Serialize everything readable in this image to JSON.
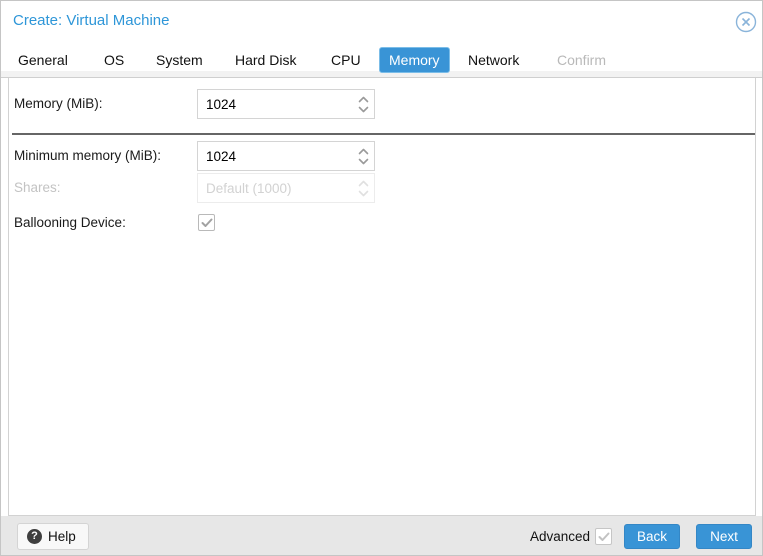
{
  "window": {
    "title": "Create: Virtual Machine",
    "close_icon": "circle-x"
  },
  "tabs": [
    {
      "label": "General",
      "state": "normal"
    },
    {
      "label": "OS",
      "state": "normal"
    },
    {
      "label": "System",
      "state": "normal"
    },
    {
      "label": "Hard Disk",
      "state": "normal"
    },
    {
      "label": "CPU",
      "state": "normal"
    },
    {
      "label": "Memory",
      "state": "active"
    },
    {
      "label": "Network",
      "state": "normal"
    },
    {
      "label": "Confirm",
      "state": "disabled"
    }
  ],
  "form": {
    "memory": {
      "label": "Memory (MiB):",
      "value": "1024",
      "disabled": false
    },
    "min_memory": {
      "label": "Minimum memory (MiB):",
      "value": "1024",
      "disabled": false
    },
    "shares": {
      "label": "Shares:",
      "value": "Default (1000)",
      "disabled": true
    },
    "ballooning": {
      "label": "Ballooning Device:",
      "checked": true
    }
  },
  "footer": {
    "help": "Help",
    "help_icon": "question-circle",
    "advanced_label": "Advanced",
    "advanced_checked": true,
    "back": "Back",
    "next": "Next"
  },
  "colors": {
    "accent_blue": "#3994d6",
    "title_blue": "#2e96d8",
    "active_tab_border": "#7bbde8",
    "separator_gray": "#666666",
    "footer_bg": "#e7e7e7",
    "panel_border": "#d2d2d2",
    "disabled_text": "#c3c3c3"
  }
}
